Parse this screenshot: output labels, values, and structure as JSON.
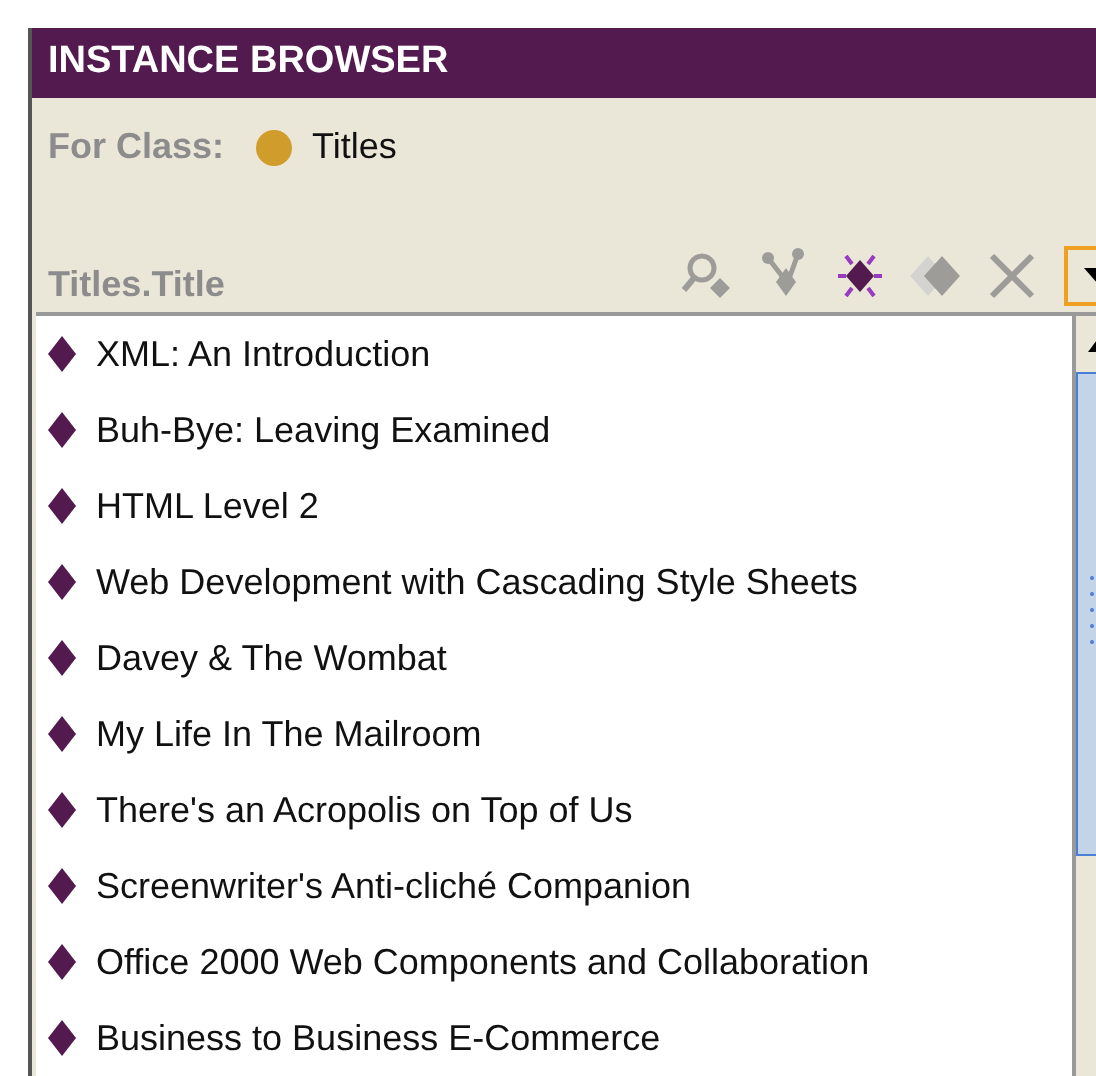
{
  "panel": {
    "title": "INSTANCE BROWSER",
    "class_label": "For Class:",
    "class_name": "Titles",
    "slot_label": "Titles.Title"
  },
  "toolbar": [
    {
      "kind": "search",
      "disabled": true
    },
    {
      "kind": "references",
      "disabled": true
    },
    {
      "kind": "create",
      "disabled": false
    },
    {
      "kind": "copy",
      "disabled": true
    },
    {
      "kind": "delete",
      "disabled": true
    },
    {
      "kind": "menu",
      "disabled": false
    }
  ],
  "instances": [
    {
      "label": "XML: An Introduction"
    },
    {
      "label": "Buh-Bye: Leaving Examined"
    },
    {
      "label": "HTML Level 2"
    },
    {
      "label": "Web Development with Cascading Style Sheets"
    },
    {
      "label": "Davey & The Wombat"
    },
    {
      "label": "My Life In The Mailroom"
    },
    {
      "label": "There's an Acropolis on Top of Us"
    },
    {
      "label": "Screenwriter's Anti-cliché Companion"
    },
    {
      "label": "Office 2000 Web Components and Collaboration"
    },
    {
      "label": "Business to Business E-Commerce"
    }
  ]
}
